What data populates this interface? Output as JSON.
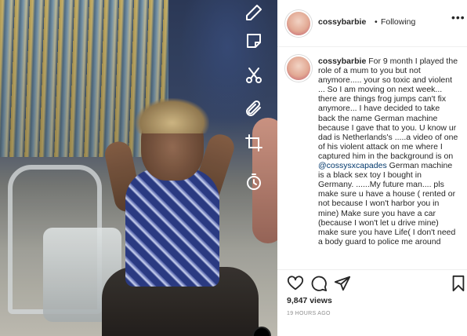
{
  "post": {
    "username": "cossybarbie",
    "follow_separator": "•",
    "follow_status": "Following",
    "more_label": "•••",
    "caption_username": "cossybarbie",
    "caption_part1": "For 9 month I played the role of a mum to you but not anymore..... your so toxic and violent ... So I am moving on next week... there are things frog jumps can't fix anymore... I have decided to take back the name German machine because I gave that to you. U know ur dad is Netherlands's .....a video of one of his violent attack on me where I captured him in the background is on ",
    "caption_mention": "@cossysxcapades",
    "caption_part2": " German machine is a black sex toy I bought in Germany. ......My future man.... pls make sure u have a house ( rented or not because I won't harbor you in mine) Make sure you have a car (because I won't let u drive mine) make sure you have Life( I don't need a body guard to police me around",
    "views": "9,847 views",
    "time_ago": "19 HOURS AGO"
  },
  "icons": {
    "video_tools": [
      "pencil-icon",
      "sticker-icon",
      "scissors-icon",
      "paperclip-icon",
      "crop-icon",
      "timer-icon"
    ],
    "actions": [
      "heart-icon",
      "comment-icon",
      "share-icon",
      "bookmark-icon"
    ]
  }
}
